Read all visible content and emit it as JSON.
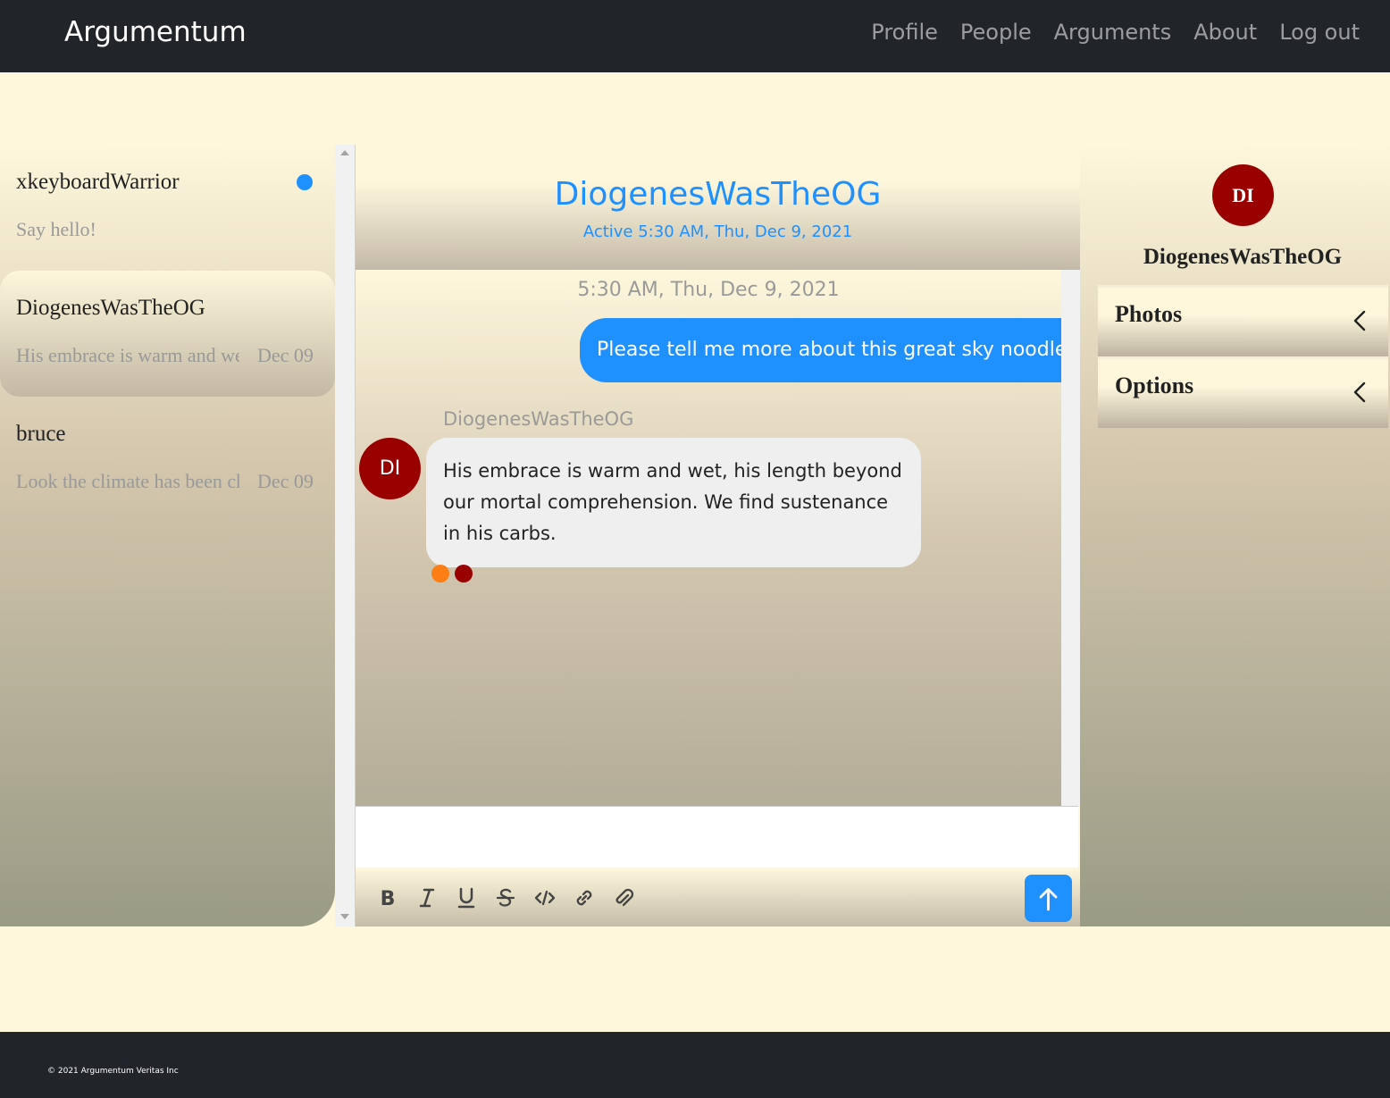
{
  "navbar": {
    "brand": "Argumentum",
    "links": [
      "Profile",
      "People",
      "Arguments",
      "About",
      "Log out"
    ]
  },
  "conversations": [
    {
      "name": "xkeyboardWarrior",
      "preview": "Say hello!",
      "date": "",
      "unread": true
    },
    {
      "name": "DiogenesWasTheOG",
      "preview": "His embrace is warm and wet, his length beyond our mortal comprehension.",
      "date": "Dec 09",
      "active": true
    },
    {
      "name": "bruce",
      "preview": "Look the climate has been changing",
      "date": "Dec 09"
    }
  ],
  "chat": {
    "title": "DiogenesWasTheOG",
    "status": "Active 5:30 AM, Thu, Dec 9, 2021",
    "timestamp": "5:30 AM, Thu, Dec 9, 2021",
    "outgoing_message": "Please tell me more about this great sky noodle!",
    "incoming_sender": "DiogenesWasTheOG",
    "incoming_avatar": "DI",
    "incoming_message": "His embrace is warm and wet, his length beyond our mortal comprehension. We find sustenance in his carbs.",
    "reaction_colors": [
      "#fd7e14",
      "#990000"
    ]
  },
  "toolbar": {
    "tools": [
      "bold-icon",
      "italic-icon",
      "underline-icon",
      "strikethrough-icon",
      "code-icon",
      "link-icon",
      "attach-icon"
    ],
    "send_icon": "arrow-up-icon",
    "accent": "#1e90ff"
  },
  "right_panel": {
    "avatar_initials": "DI",
    "name": "DiogenesWasTheOG",
    "sections": [
      "Photos",
      "Options"
    ]
  },
  "footer": {
    "text": "© 2021 Argumentum Veritas Inc"
  }
}
